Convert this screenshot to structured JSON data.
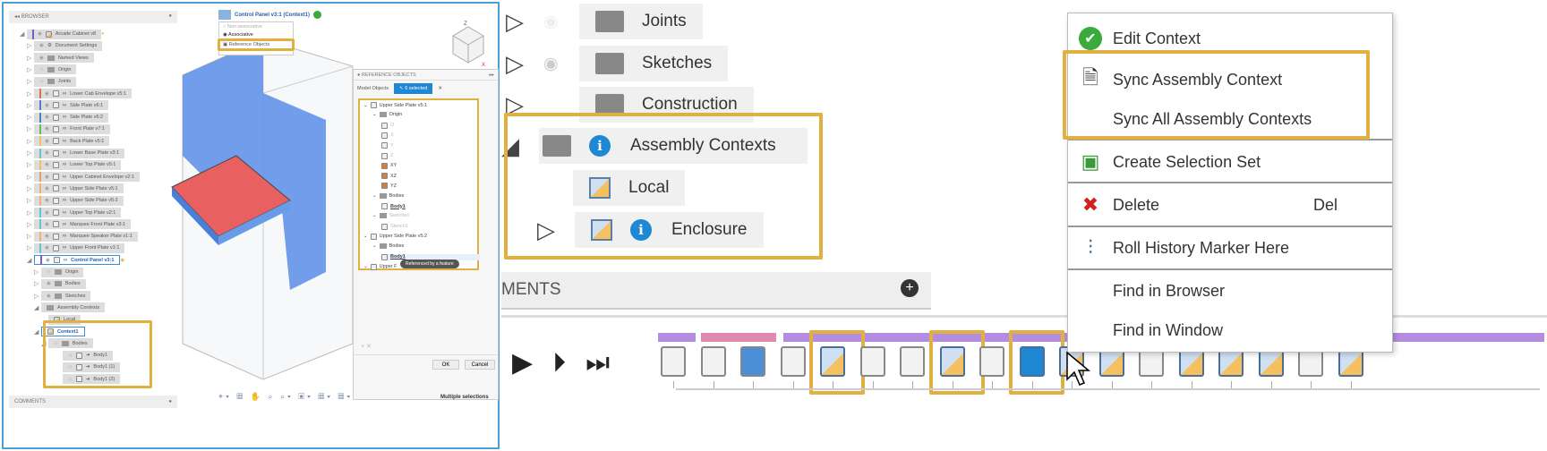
{
  "left": {
    "browser": {
      "title": "BROWSER",
      "comments": "COMMENTS",
      "items": [
        {
          "label": "Arcade Cabinet v8",
          "depth": 0,
          "expanded": true,
          "color": "#7a5ccc",
          "kind": "root"
        },
        {
          "label": "Document Settings",
          "depth": 1,
          "kind": "gear"
        },
        {
          "label": "Named Views",
          "depth": 1,
          "kind": "folder"
        },
        {
          "label": "Origin",
          "depth": 1,
          "kind": "folder",
          "eye": "hidden"
        },
        {
          "label": "Joints",
          "depth": 1,
          "kind": "folder",
          "eye": "hidden"
        },
        {
          "label": "Lower Cab Envelope v5:1",
          "depth": 1,
          "kind": "link",
          "color": "#e07050"
        },
        {
          "label": "Side Plate v6:1",
          "depth": 1,
          "kind": "link",
          "color": "#4a80d0"
        },
        {
          "label": "Side Plate v6:2",
          "depth": 1,
          "kind": "link",
          "color": "#4a80d0"
        },
        {
          "label": "Front Plate v7:1",
          "depth": 1,
          "kind": "link",
          "color": "#60c060"
        },
        {
          "label": "Back Plate v5:1",
          "depth": 1,
          "kind": "link",
          "color": "#f0c060"
        },
        {
          "label": "Lower Base Plate v3:1",
          "depth": 1,
          "kind": "link",
          "color": "#60c8d0"
        },
        {
          "label": "Lower Top Plate v5:1",
          "depth": 1,
          "kind": "link",
          "color": "#f0c060"
        },
        {
          "label": "Upper Cabinet Envelope v2:1",
          "depth": 1,
          "kind": "link",
          "color": "#e0a070"
        },
        {
          "label": "Upper Side Plate v5:1",
          "depth": 1,
          "kind": "link",
          "color": "#f0b070"
        },
        {
          "label": "Upper Side Plate v5:2",
          "depth": 1,
          "kind": "link",
          "color": "#f0b070"
        },
        {
          "label": "Upper Top Plate v2:1",
          "depth": 1,
          "kind": "link",
          "color": "#60c8d0"
        },
        {
          "label": "Marquee Front Plate v3:1",
          "depth": 1,
          "kind": "link",
          "color": "#60c8d0"
        },
        {
          "label": "Marquee Speaker Plate v1:1",
          "depth": 1,
          "kind": "link",
          "color": "#f0b070"
        },
        {
          "label": "Upper Front Plate v1:1",
          "depth": 1,
          "kind": "link",
          "color": "#60c8d0"
        },
        {
          "label": "Control Panel v3:1",
          "depth": 1,
          "expanded": true,
          "kind": "link",
          "color": "#7a5ccc",
          "active": true
        },
        {
          "label": "Origin",
          "depth": 2,
          "kind": "folder",
          "eye": "hidden"
        },
        {
          "label": "Bodies",
          "depth": 2,
          "kind": "folder"
        },
        {
          "label": "Sketches",
          "depth": 2,
          "kind": "folder"
        },
        {
          "label": "Assembly Contexts",
          "depth": 2,
          "expanded": true,
          "kind": "folder",
          "noeye": true
        },
        {
          "label": "Local",
          "depth": 3,
          "kind": "context",
          "noeye": true,
          "notri": true
        },
        {
          "label": "Context1",
          "depth": 2,
          "expanded": true,
          "kind": "context",
          "noeye": true,
          "active": true
        },
        {
          "label": "Bodies",
          "depth": 3,
          "expanded": true,
          "kind": "folder",
          "eye": "hidden"
        },
        {
          "label": "Body1",
          "depth": 5,
          "kind": "body",
          "eye": "hidden",
          "notri": true
        },
        {
          "label": "Body1 (1)",
          "depth": 5,
          "kind": "body",
          "eye": "hidden",
          "notri": true
        },
        {
          "label": "Body1 (2)",
          "depth": 5,
          "kind": "body",
          "eye": "hidden",
          "notri": true
        }
      ]
    },
    "viewport": {
      "context_title": "Control Panel v3:1 (Context1)",
      "dropdown": {
        "options": [
          "Non-associative",
          "Associative",
          "Reference Objects"
        ],
        "selected": "Associative"
      },
      "status": "Multiple selections",
      "viewcube": {
        "axes": [
          "Z",
          "X"
        ]
      }
    },
    "ref_panel": {
      "title": "REFERENCE OBJECTS",
      "tab": "Model Objects",
      "selected_label": "6 selected",
      "tree": [
        {
          "label": "Upper Side Plate v5:1",
          "depth": 0
        },
        {
          "label": "Origin",
          "depth": 1
        },
        {
          "label": "O",
          "depth": 2,
          "muted": true
        },
        {
          "label": "X",
          "depth": 2,
          "muted": true
        },
        {
          "label": "Y",
          "depth": 2,
          "muted": true
        },
        {
          "label": "Z",
          "depth": 2,
          "muted": true
        },
        {
          "label": "XY",
          "depth": 2
        },
        {
          "label": "XZ",
          "depth": 2
        },
        {
          "label": "YZ",
          "depth": 2
        },
        {
          "label": "Bodies",
          "depth": 1
        },
        {
          "label": "Body1",
          "depth": 2,
          "underline": true
        },
        {
          "label": "Sketches",
          "depth": 1,
          "muted": true
        },
        {
          "label": "Sketch1",
          "depth": 2,
          "muted": true
        },
        {
          "label": "Upper Side Plate v5:2",
          "depth": 0
        },
        {
          "label": "Bodies",
          "depth": 1
        },
        {
          "label": "Body1",
          "depth": 2,
          "underline": true,
          "highlight": true
        },
        {
          "label": "Upper F",
          "depth": 0
        }
      ],
      "tooltip": "Referenced by a feature",
      "ok": "OK",
      "cancel": "Cancel"
    }
  },
  "right": {
    "tree": [
      {
        "label": "Joints",
        "eye": "hidden"
      },
      {
        "label": "Sketches",
        "eye": "visible"
      },
      {
        "label": "Construction",
        "eye": "none"
      },
      {
        "label": "Assembly Contexts"
      },
      {
        "label": "Local"
      },
      {
        "label": "Enclosure"
      }
    ],
    "comments_label": "MENTS",
    "context_menu": [
      {
        "label": "Edit Context",
        "icon": "check-circle"
      },
      {
        "label": "Sync Assembly Context",
        "icon": "document-sync"
      },
      {
        "label": "Sync All Assembly Contexts",
        "icon": ""
      },
      {
        "label": "Create Selection Set",
        "icon": "selection-set"
      },
      {
        "label": "Delete",
        "icon": "red-x",
        "shortcut": "Del"
      },
      {
        "label": "Roll History Marker Here",
        "icon": "history-marker"
      },
      {
        "label": "Find in Browser",
        "icon": ""
      },
      {
        "label": "Find in Window",
        "icon": ""
      }
    ],
    "timeline": {
      "features": [
        "box",
        "sketch",
        "extrude",
        "joint",
        "context",
        "joint",
        "joint-2",
        "context",
        "joint",
        "context",
        "context",
        "context",
        "sketch",
        "context",
        "context",
        "context",
        "joint",
        "context"
      ],
      "highlighted": [
        4,
        7,
        9
      ],
      "selected": 9
    },
    "colors": {
      "accent": "#1e88d4",
      "highlight": "#e0b040",
      "purple": "#b48ce0",
      "pink": "#e08ab0"
    }
  }
}
